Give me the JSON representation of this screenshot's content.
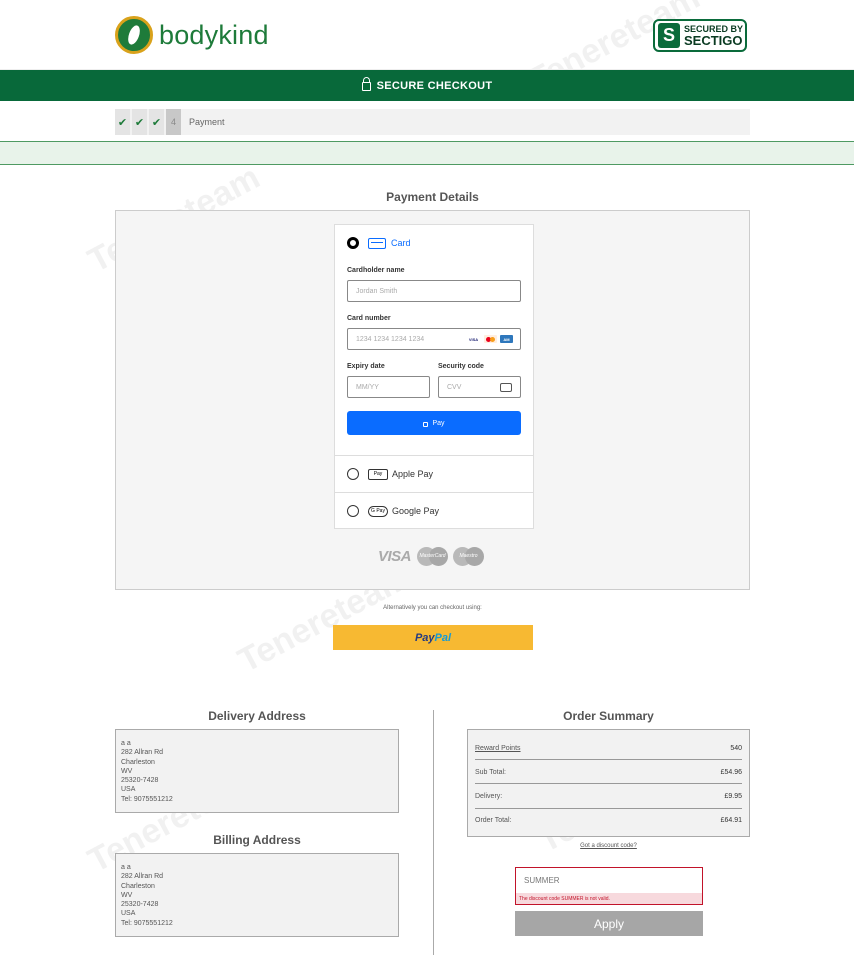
{
  "header": {
    "logo_text": "bodykind",
    "badge": {
      "line1": "SECURED BY",
      "line2": "SECTIGO",
      "mark": "S"
    }
  },
  "secure_bar": {
    "label": "SECURE CHECKOUT"
  },
  "steps": {
    "items": [
      {
        "state": "done",
        "glyph": "✔"
      },
      {
        "state": "done",
        "glyph": "✔"
      },
      {
        "state": "done",
        "glyph": "✔"
      },
      {
        "state": "current",
        "glyph": "4"
      }
    ],
    "current_label": "Payment"
  },
  "payment": {
    "title": "Payment Details",
    "methods": {
      "card": {
        "label": "Card",
        "selected": true
      },
      "apple_pay": {
        "label": "Apple Pay",
        "badge": "Pay"
      },
      "google_pay": {
        "label": "Google Pay",
        "badge": "G Pay"
      }
    },
    "cardholder": {
      "label": "Cardholder name",
      "placeholder": "Jordan Smith"
    },
    "card_number": {
      "label": "Card number",
      "placeholder": "1234 1234 1234 1234"
    },
    "expiry": {
      "label": "Expiry date",
      "placeholder": "MM/YY"
    },
    "security": {
      "label": "Security code",
      "placeholder": "CVV"
    },
    "pay_button": "Pay",
    "accepted": {
      "visa": "VISA",
      "mastercard": "MasterCard",
      "maestro": "Maestro"
    }
  },
  "alternative": {
    "text": "Alternatively you can checkout using:",
    "paypal_1": "Pay",
    "paypal_2": "Pal"
  },
  "delivery": {
    "title": "Delivery Address",
    "lines": [
      "a a",
      "282 Allran Rd",
      "Charleston",
      "WV",
      "25320-7428",
      "USA",
      "Tel: 9075551212"
    ]
  },
  "billing": {
    "title": "Billing Address",
    "lines": [
      "a a",
      "282 Allran Rd",
      "Charleston",
      "WV",
      "25320-7428",
      "USA",
      "Tel: 9075551212"
    ]
  },
  "summary": {
    "title": "Order Summary",
    "rows": [
      {
        "label": "Reward Points",
        "value": "540"
      },
      {
        "label": "Sub Total:",
        "value": "£54.96"
      },
      {
        "label": "Delivery:",
        "value": "£9.95"
      },
      {
        "label": "Order Total:",
        "value": "£64.91"
      }
    ],
    "discount_link": "Got a discount code?",
    "discount_value": "SUMMER",
    "discount_error": "The discount code SUMMER is not valid.",
    "apply_button": "Apply"
  },
  "watermark": "Tenereteam",
  "colors": {
    "brand_green": "#08693a",
    "stripe_blue": "#0a6cff",
    "paypal_yellow": "#f7b932",
    "error_red": "#c2132a"
  }
}
